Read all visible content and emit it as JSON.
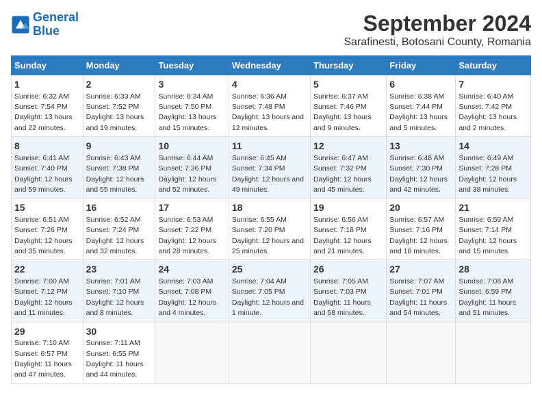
{
  "logo": {
    "line1": "General",
    "line2": "Blue"
  },
  "title": "September 2024",
  "subtitle": "Sarafinesti, Botosani County, Romania",
  "days_of_week": [
    "Sunday",
    "Monday",
    "Tuesday",
    "Wednesday",
    "Thursday",
    "Friday",
    "Saturday"
  ],
  "weeks": [
    [
      {
        "day": "1",
        "sunrise": "6:32 AM",
        "sunset": "7:54 PM",
        "daylight": "13 hours and 22 minutes."
      },
      {
        "day": "2",
        "sunrise": "6:33 AM",
        "sunset": "7:52 PM",
        "daylight": "13 hours and 19 minutes."
      },
      {
        "day": "3",
        "sunrise": "6:34 AM",
        "sunset": "7:50 PM",
        "daylight": "13 hours and 15 minutes."
      },
      {
        "day": "4",
        "sunrise": "6:36 AM",
        "sunset": "7:48 PM",
        "daylight": "13 hours and 12 minutes."
      },
      {
        "day": "5",
        "sunrise": "6:37 AM",
        "sunset": "7:46 PM",
        "daylight": "13 hours and 9 minutes."
      },
      {
        "day": "6",
        "sunrise": "6:38 AM",
        "sunset": "7:44 PM",
        "daylight": "13 hours and 5 minutes."
      },
      {
        "day": "7",
        "sunrise": "6:40 AM",
        "sunset": "7:42 PM",
        "daylight": "13 hours and 2 minutes."
      }
    ],
    [
      {
        "day": "8",
        "sunrise": "6:41 AM",
        "sunset": "7:40 PM",
        "daylight": "12 hours and 59 minutes."
      },
      {
        "day": "9",
        "sunrise": "6:43 AM",
        "sunset": "7:38 PM",
        "daylight": "12 hours and 55 minutes."
      },
      {
        "day": "10",
        "sunrise": "6:44 AM",
        "sunset": "7:36 PM",
        "daylight": "12 hours and 52 minutes."
      },
      {
        "day": "11",
        "sunrise": "6:45 AM",
        "sunset": "7:34 PM",
        "daylight": "12 hours and 49 minutes."
      },
      {
        "day": "12",
        "sunrise": "6:47 AM",
        "sunset": "7:32 PM",
        "daylight": "12 hours and 45 minutes."
      },
      {
        "day": "13",
        "sunrise": "6:48 AM",
        "sunset": "7:30 PM",
        "daylight": "12 hours and 42 minutes."
      },
      {
        "day": "14",
        "sunrise": "6:49 AM",
        "sunset": "7:28 PM",
        "daylight": "12 hours and 38 minutes."
      }
    ],
    [
      {
        "day": "15",
        "sunrise": "6:51 AM",
        "sunset": "7:26 PM",
        "daylight": "12 hours and 35 minutes."
      },
      {
        "day": "16",
        "sunrise": "6:52 AM",
        "sunset": "7:24 PM",
        "daylight": "12 hours and 32 minutes."
      },
      {
        "day": "17",
        "sunrise": "6:53 AM",
        "sunset": "7:22 PM",
        "daylight": "12 hours and 28 minutes."
      },
      {
        "day": "18",
        "sunrise": "6:55 AM",
        "sunset": "7:20 PM",
        "daylight": "12 hours and 25 minutes."
      },
      {
        "day": "19",
        "sunrise": "6:56 AM",
        "sunset": "7:18 PM",
        "daylight": "12 hours and 21 minutes."
      },
      {
        "day": "20",
        "sunrise": "6:57 AM",
        "sunset": "7:16 PM",
        "daylight": "12 hours and 18 minutes."
      },
      {
        "day": "21",
        "sunrise": "6:59 AM",
        "sunset": "7:14 PM",
        "daylight": "12 hours and 15 minutes."
      }
    ],
    [
      {
        "day": "22",
        "sunrise": "7:00 AM",
        "sunset": "7:12 PM",
        "daylight": "12 hours and 11 minutes."
      },
      {
        "day": "23",
        "sunrise": "7:01 AM",
        "sunset": "7:10 PM",
        "daylight": "12 hours and 8 minutes."
      },
      {
        "day": "24",
        "sunrise": "7:03 AM",
        "sunset": "7:08 PM",
        "daylight": "12 hours and 4 minutes."
      },
      {
        "day": "25",
        "sunrise": "7:04 AM",
        "sunset": "7:05 PM",
        "daylight": "12 hours and 1 minute."
      },
      {
        "day": "26",
        "sunrise": "7:05 AM",
        "sunset": "7:03 PM",
        "daylight": "11 hours and 58 minutes."
      },
      {
        "day": "27",
        "sunrise": "7:07 AM",
        "sunset": "7:01 PM",
        "daylight": "11 hours and 54 minutes."
      },
      {
        "day": "28",
        "sunrise": "7:08 AM",
        "sunset": "6:59 PM",
        "daylight": "11 hours and 51 minutes."
      }
    ],
    [
      {
        "day": "29",
        "sunrise": "7:10 AM",
        "sunset": "6:57 PM",
        "daylight": "11 hours and 47 minutes."
      },
      {
        "day": "30",
        "sunrise": "7:11 AM",
        "sunset": "6:55 PM",
        "daylight": "11 hours and 44 minutes."
      },
      null,
      null,
      null,
      null,
      null
    ]
  ]
}
